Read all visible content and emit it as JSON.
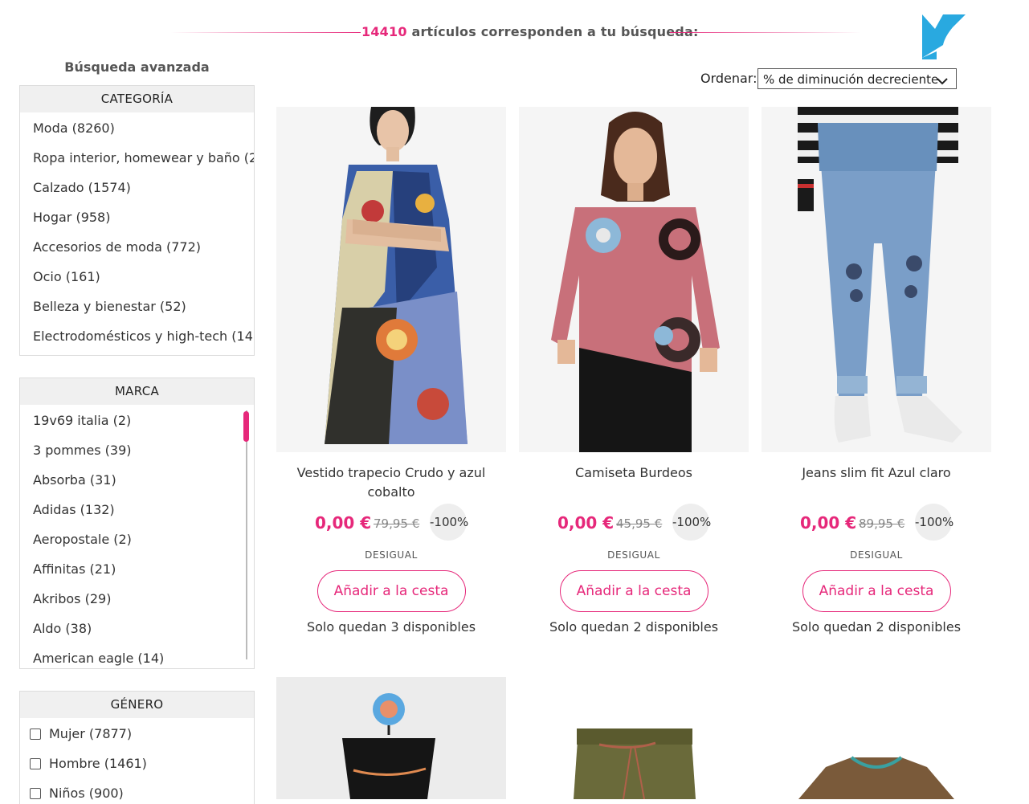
{
  "results": {
    "count": "14410",
    "text": "artículos corresponden a tu búsqueda:"
  },
  "sidebar": {
    "advanced_search": "Búsqueda avanzada",
    "category": {
      "title": "CATEGORÍA",
      "items": [
        "Moda (8260)",
        "Ropa interior, homewear y baño (2",
        "Calzado (1574)",
        "Hogar (958)",
        "Accesorios de moda (772)",
        "Ocio (161)",
        "Belleza y bienestar (52)",
        "Electrodomésticos y high-tech (14)"
      ]
    },
    "brand": {
      "title": "MARCA",
      "items": [
        "19v69 italia (2)",
        "3 pommes (39)",
        "Absorba (31)",
        "Adidas (132)",
        "Aeropostale (2)",
        "Affinitas (21)",
        "Akribos (29)",
        "Aldo (38)",
        "American eagle (14)"
      ]
    },
    "gender": {
      "title": "GÉNERO",
      "items": [
        "Mujer (7877)",
        "Hombre (1461)",
        "Niños (900)"
      ]
    }
  },
  "sort": {
    "label": "Ordenar:",
    "value": "% de diminución decreciente"
  },
  "products": [
    {
      "name": "Vestido trapecio Crudo y azul cobalto",
      "price": "0,00 €",
      "old_price": "79,95 €",
      "discount": "-100%",
      "brand": "DESIGUAL",
      "cart_label": "Añadir a la cesta",
      "stock": "Solo quedan 3 disponibles"
    },
    {
      "name": "Camiseta Burdeos",
      "price": "0,00 €",
      "old_price": "45,95 €",
      "discount": "-100%",
      "brand": "DESIGUAL",
      "cart_label": "Añadir a la cesta",
      "stock": "Solo quedan 2 disponibles"
    },
    {
      "name": "Jeans slim fit Azul claro",
      "price": "0,00 €",
      "old_price": "89,95 €",
      "discount": "-100%",
      "brand": "DESIGUAL",
      "cart_label": "Añadir a la cesta",
      "stock": "Solo quedan 2 disponibles"
    }
  ],
  "colors": {
    "accent": "#e6287a",
    "logo": "#29a9e0",
    "filter_header": "#f0f0f0"
  },
  "icons": {
    "logo": "brand-logo-icon",
    "sort": "chevron-down-icon",
    "checkbox": "checkbox-icon"
  }
}
